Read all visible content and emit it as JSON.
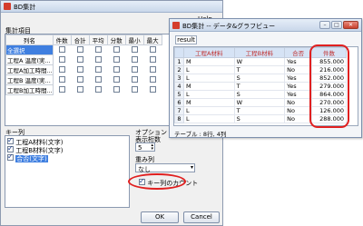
{
  "main_window": {
    "title": "BD集計",
    "help_label": "Help",
    "group_label": "集計項目",
    "col_headers": [
      "列名",
      "件数",
      "合計",
      "平均",
      "分散",
      "最小",
      "最大"
    ],
    "rows": [
      "全選択",
      "工程A 温度(実...",
      "工程A加工時間...",
      "工程B 温度(実...",
      "工程B加工時間..."
    ],
    "key_label": "キー列",
    "key_items": [
      "工程A材料(文字)",
      "工程B材料(文字)",
      "合否(文字)"
    ],
    "options_label": "オプション",
    "digits_label": "表示桁数",
    "digits_value": "5",
    "weight_label": "重み列",
    "weight_value": "なし",
    "key_count_label": "キー列のカウント",
    "ok_label": "OK",
    "cancel_label": "Cancel"
  },
  "data_window": {
    "title": "BD集計 -- データ&グラフビュー",
    "tab": "result",
    "columns": [
      "工程A材料",
      "工程B材料",
      "合否",
      "件数"
    ],
    "rows": [
      {
        "n": "1",
        "a": "M",
        "b": "W",
        "c": "Yes",
        "d": "855.000"
      },
      {
        "n": "2",
        "a": "L",
        "b": "T",
        "c": "No",
        "d": "216.000"
      },
      {
        "n": "3",
        "a": "L",
        "b": "S",
        "c": "Yes",
        "d": "852.000"
      },
      {
        "n": "4",
        "a": "M",
        "b": "T",
        "c": "Yes",
        "d": "279.000"
      },
      {
        "n": "5",
        "a": "L",
        "b": "S",
        "c": "Yes",
        "d": "864.000"
      },
      {
        "n": "6",
        "a": "M",
        "b": "W",
        "c": "No",
        "d": "270.000"
      },
      {
        "n": "7",
        "a": "L",
        "b": "T",
        "c": "No",
        "d": "126.000"
      },
      {
        "n": "8",
        "a": "L",
        "b": "S",
        "c": "No",
        "d": "288.000"
      }
    ],
    "status": "テーブル : 8行, 4列"
  },
  "colors": {
    "highlight": "#e02020",
    "selection": "#3f7fe0",
    "header": "#d6e3f5"
  }
}
